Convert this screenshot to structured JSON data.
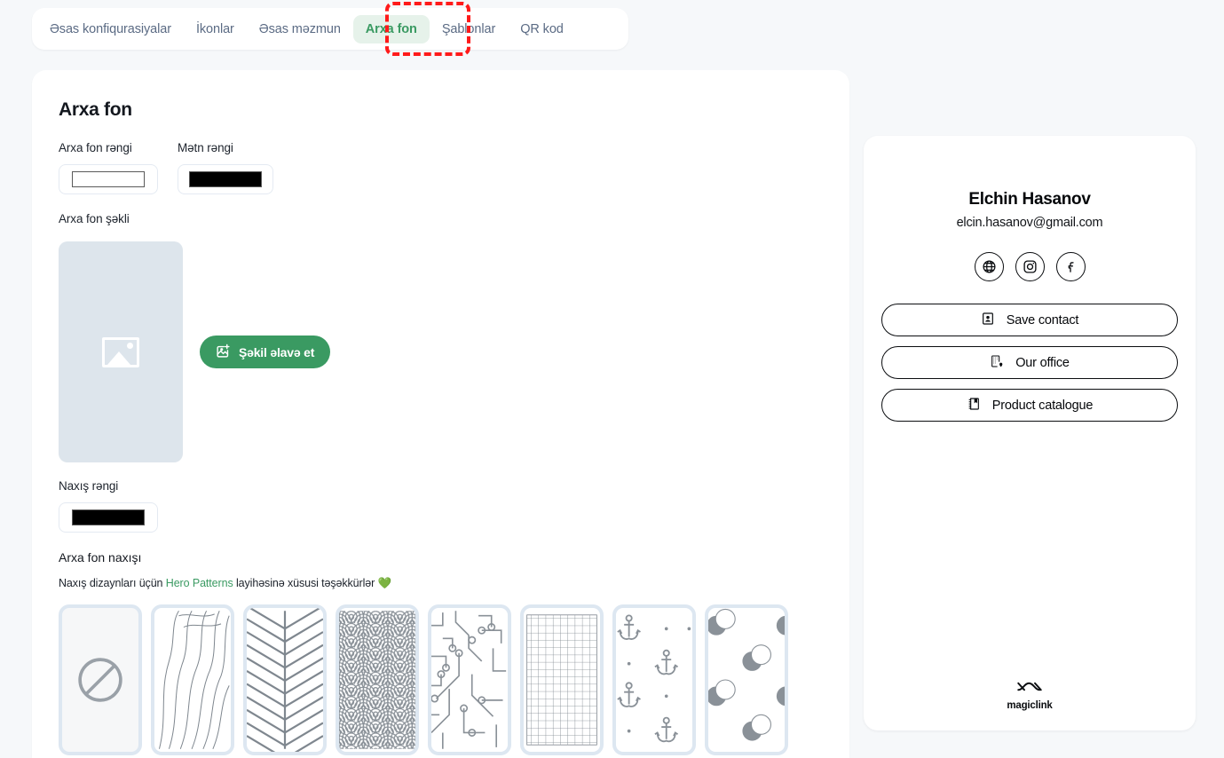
{
  "tabs": [
    {
      "label": "Əsas konfiqurasiyalar",
      "active": false
    },
    {
      "label": "İkonlar",
      "active": false
    },
    {
      "label": "Əsas məzmun",
      "active": false
    },
    {
      "label": "Arxa fon",
      "active": true
    },
    {
      "label": "Şablonlar",
      "active": false
    },
    {
      "label": "QR kod",
      "active": false
    }
  ],
  "editor": {
    "section_title": "Arxa fon",
    "bg_color_label": "Arxa fon rəngi",
    "bg_color_value": "#ffffff",
    "text_color_label": "Mətn rəngi",
    "text_color_value": "#000000",
    "bg_image_label": "Arxa fon şəkli",
    "add_image_button": "Şəkil əlavə et",
    "pattern_color_label": "Naxış rəngi",
    "pattern_color_value": "#000000",
    "bg_pattern_label": "Arxa fon naxışı",
    "credit_prefix": "Naxış dizaynları üçün ",
    "credit_link": "Hero Patterns",
    "credit_suffix": " layihəsinə xüsusi təşəkkürlər ",
    "credit_emoji": "💚",
    "patterns": [
      {
        "name": "none",
        "selected": true
      },
      {
        "name": "topography",
        "selected": false
      },
      {
        "name": "chevron",
        "selected": false
      },
      {
        "name": "seigaiha",
        "selected": false
      },
      {
        "name": "circuit-board",
        "selected": false
      },
      {
        "name": "graph-paper",
        "selected": false
      },
      {
        "name": "anchors",
        "selected": false
      },
      {
        "name": "overlapping-circles",
        "selected": false
      }
    ]
  },
  "preview": {
    "name": "Elchin Hasanov",
    "email": "elcin.hasanov@gmail.com",
    "social": [
      {
        "icon": "globe-icon",
        "name": "website"
      },
      {
        "icon": "instagram-icon",
        "name": "instagram"
      },
      {
        "icon": "facebook-icon",
        "name": "facebook"
      }
    ],
    "actions": [
      {
        "icon": "contact-card-icon",
        "label": "Save contact"
      },
      {
        "icon": "office-building-icon",
        "label": "Our office"
      },
      {
        "icon": "catalogue-book-icon",
        "label": "Product catalogue"
      }
    ],
    "footer_brand": "magiclink"
  },
  "annotation": {
    "target": "Arxa fon",
    "color": "#ff1a1a"
  }
}
